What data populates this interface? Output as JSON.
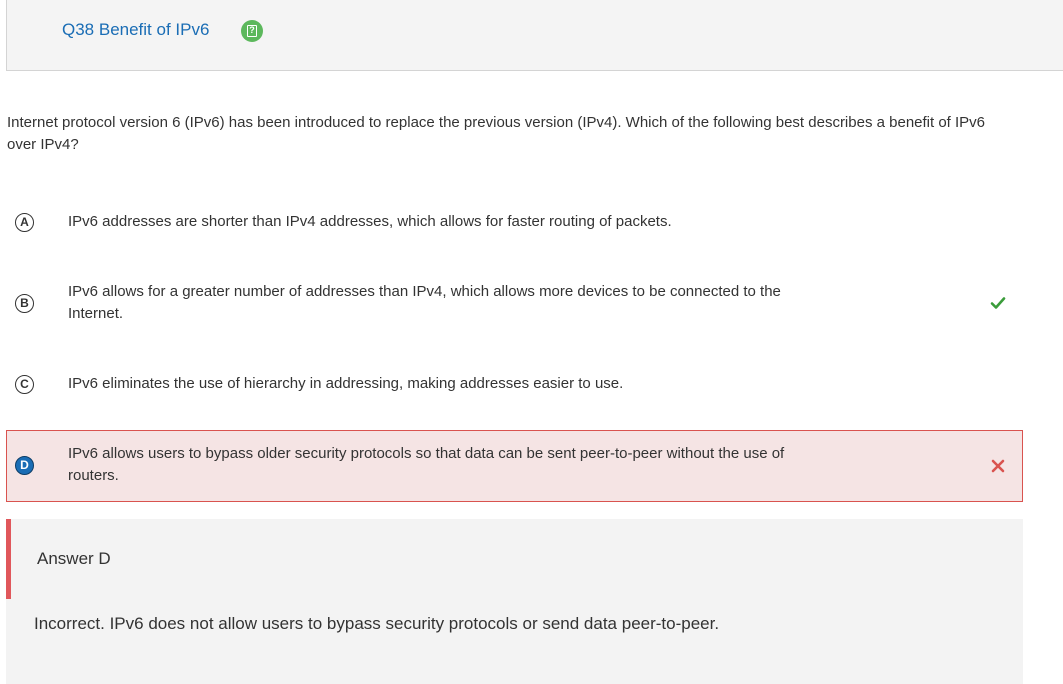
{
  "header": {
    "title": "Q38 Benefit of IPv6",
    "hint_icon": "question-mark-icon",
    "hint_glyph": "?"
  },
  "question": {
    "text": "Internet protocol version 6 (IPv6) has been introduced to replace the previous version (IPv4). Which of the following best describes a benefit of IPv6 over IPv4?"
  },
  "options": [
    {
      "letter": "A",
      "text": "IPv6 addresses are shorter than IPv4 addresses, which allows for faster routing of packets.",
      "state": "unselected"
    },
    {
      "letter": "B",
      "text": "IPv6 allows for a greater number of addresses than IPv4, which allows more devices to be connected to the Internet.",
      "state": "correct",
      "mark_icon": "checkmark-icon"
    },
    {
      "letter": "C",
      "text": "IPv6 eliminates the use of hierarchy in addressing, making addresses easier to use.",
      "state": "unselected"
    },
    {
      "letter": "D",
      "text": "IPv6 allows users to bypass older security protocols so that data can be sent peer-to-peer without the use of routers.",
      "state": "selected-incorrect",
      "mark_icon": "cross-icon"
    }
  ],
  "answer": {
    "title": "Answer D",
    "explanation": "Incorrect. IPv6 does not allow users to bypass security protocols or send data peer-to-peer."
  },
  "colors": {
    "title_blue": "#1a6db5",
    "hint_green": "#5cb85c",
    "correct_green": "#3a9c3a",
    "incorrect_red": "#d9534f",
    "wrong_bg": "#f5e4e4",
    "answer_bar": "#e0575b",
    "answer_bg": "#f3f3f3"
  }
}
